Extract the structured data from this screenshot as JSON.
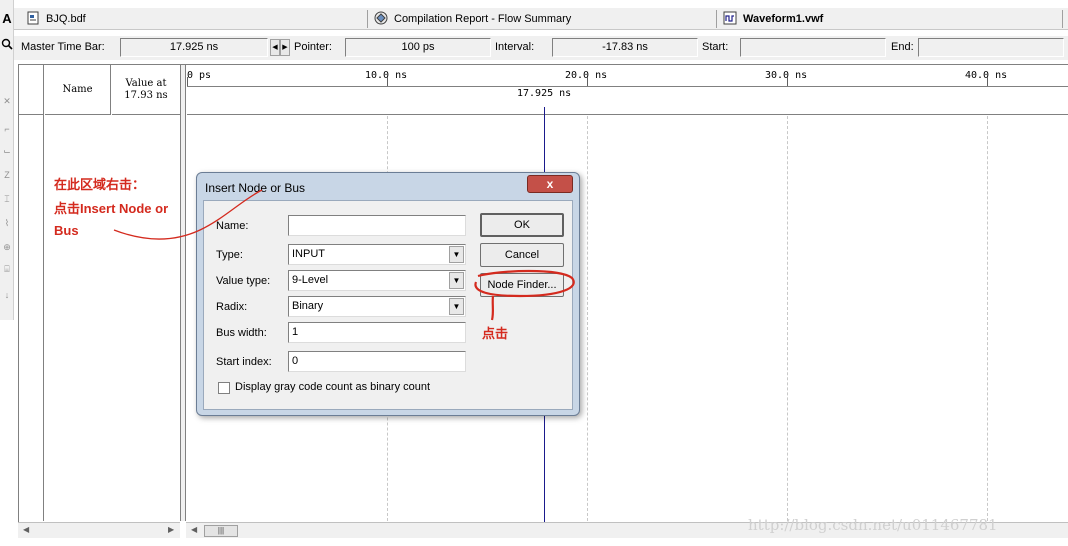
{
  "tabs": [
    {
      "label": "BJQ.bdf",
      "icon": "block-diagram-icon",
      "active": false
    },
    {
      "label": "Compilation Report - Flow Summary",
      "icon": "report-icon",
      "active": false
    },
    {
      "label": "Waveform1.vwf",
      "icon": "waveform-icon",
      "active": true
    }
  ],
  "time_bar": {
    "master_label": "Master Time Bar:",
    "master_value": "17.925 ns",
    "pointer_label": "Pointer:",
    "pointer_value": "100 ps",
    "interval_label": "Interval:",
    "interval_value": "-17.83 ns",
    "start_label": "Start:",
    "start_value": "",
    "end_label": "End:",
    "end_value": ""
  },
  "waveform": {
    "name_header": "Name",
    "value_header_line1": "Value at",
    "value_header_line2": "17.93 ns",
    "ruler_labels": [
      "0 ps",
      "10.0 ns",
      "20.0 ns",
      "30.0 ns",
      "40.0 ns"
    ],
    "cursor_label": "17.925 ns"
  },
  "dialog": {
    "title": "Insert Node or Bus",
    "close_symbol": "x",
    "name_label": "Name:",
    "name_value": "",
    "type_label": "Type:",
    "type_value": "INPUT",
    "value_type_label": "Value type:",
    "value_type_value": "9-Level",
    "radix_label": "Radix:",
    "radix_value": "Binary",
    "bus_width_label": "Bus width:",
    "bus_width_value": "1",
    "start_index_label": "Start index:",
    "start_index_value": "0",
    "ok_label": "OK",
    "cancel_label": "Cancel",
    "node_finder_label": "Node Finder...",
    "gray_code_label": "Display gray code count as binary count",
    "gray_code_checked": false
  },
  "annotations": {
    "line1": "在此区域右击：",
    "line2": "点击Insert Node or",
    "line3": "Bus",
    "click_note": "点击",
    "color": "#d42a1e"
  },
  "watermark": "http://blog.csdn.net/u011467781"
}
